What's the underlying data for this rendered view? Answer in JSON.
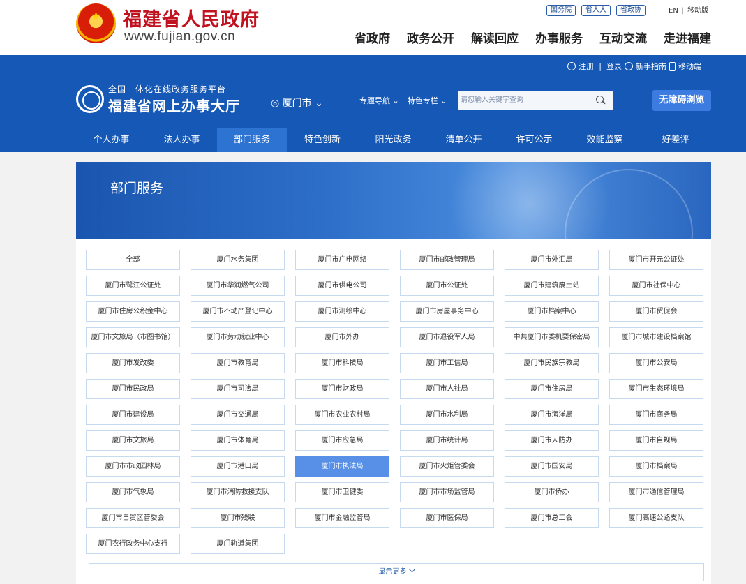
{
  "gov": {
    "title": "福建省人民政府",
    "url": "www.fujian.gov.cn",
    "quick_links": [
      "国务院",
      "省人大",
      "省政协"
    ],
    "lang": [
      "EN",
      "移动版"
    ],
    "nav": [
      "省政府",
      "政务公开",
      "解读回应",
      "办事服务",
      "互动交流",
      "走进福建"
    ]
  },
  "portal": {
    "user_links": {
      "register": "注册",
      "login": "登录",
      "guide": "新手指南",
      "mobile": "移动端"
    },
    "logo_sub": "全国一体化在线政务服务平台",
    "logo_main": "福建省网上办事大厅",
    "city": "厦门市",
    "topic_menu": [
      "专题导航",
      "特色专栏"
    ],
    "search_placeholder": "请您输入关键字查询",
    "accessibility": "无障碍浏览"
  },
  "main_nav": {
    "items": [
      "个人办事",
      "法人办事",
      "部门服务",
      "特色创新",
      "阳光政务",
      "清单公开",
      "许可公示",
      "效能监察",
      "好差评"
    ],
    "active": "部门服务"
  },
  "banner": {
    "title": "部门服务"
  },
  "departments": [
    "全部",
    "厦门水务集团",
    "厦门市广电网络",
    "厦门市邮政管理局",
    "厦门市外汇局",
    "厦门市开元公证处",
    "厦门市鹭江公证处",
    "厦门市华润燃气公司",
    "厦门市供电公司",
    "厦门市公证处",
    "厦门市建筑废土站",
    "厦门市社保中心",
    "厦门市住房公积金中心",
    "厦门市不动产登记中心",
    "厦门市测绘中心",
    "厦门市房屋事务中心",
    "厦门市档案中心",
    "厦门市贸促会",
    "厦门市文旅局（市图书馆）",
    "厦门市劳动就业中心",
    "厦门市外办",
    "厦门市退役军人局",
    "中共厦门市委机要保密局",
    "厦门市城市建设档案馆",
    "厦门市发改委",
    "厦门市教育局",
    "厦门市科技局",
    "厦门市工信局",
    "厦门市民族宗教局",
    "厦门市公安局",
    "厦门市民政局",
    "厦门市司法局",
    "厦门市财政局",
    "厦门市人社局",
    "厦门市住房局",
    "厦门市生态环境局",
    "厦门市建设局",
    "厦门市交通局",
    "厦门市农业农村局",
    "厦门市水利局",
    "厦门市海洋局",
    "厦门市商务局",
    "厦门市文旅局",
    "厦门市体育局",
    "厦门市应急局",
    "厦门市统计局",
    "厦门市人防办",
    "厦门市自规局",
    "厦门市市政园林局",
    "厦门市港口局",
    "厦门市执法局",
    "厦门市火炬管委会",
    "厦门市国安局",
    "厦门市档案局",
    "厦门市气象局",
    "厦门市消防救援支队",
    "厦门市卫健委",
    "厦门市市场监管局",
    "厦门市侨办",
    "厦门市通信管理局",
    "厦门市自贸区管委会",
    "厦门市残联",
    "厦门市金融监管局",
    "厦门市医保局",
    "厦门市总工会",
    "厦门高速公路支队",
    "厦门农行政务中心支行",
    "厦门轨道集团"
  ],
  "active_department": "厦门市执法局",
  "show_more": "显示更多"
}
